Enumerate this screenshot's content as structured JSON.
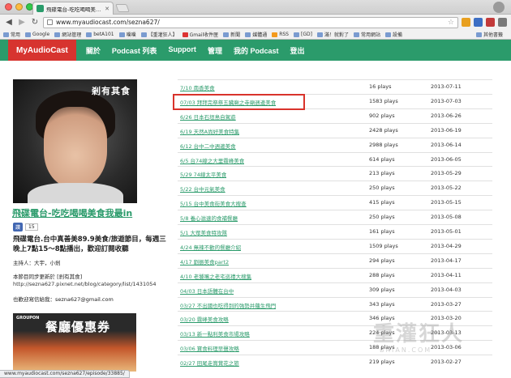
{
  "browser": {
    "tab_title": "飛碟電台-吃吃喝喝美食我最...",
    "url": "www.myaudiocast.com/sezna627/",
    "bookmarks": [
      "常用",
      "Google",
      "網站管理",
      "betA101",
      "噗噗",
      "【重灌狂人】",
      "Gmail收件匣",
      "新聞",
      "媒體通",
      "RSS",
      "[GD]",
      "滿！就對了",
      "常用網站",
      "設備"
    ],
    "bookmarks_more": "其他書籤",
    "status_url": "www.myaudiocast.com/sezna627/episode/33885/"
  },
  "nav": {
    "brand": "MyAudioCast",
    "links": [
      "關於",
      "Podcast 列表",
      "Support",
      "管理",
      "我的 Podcast",
      "登出"
    ]
  },
  "show": {
    "cover_text": "剎有其食",
    "title": "飛碟電台-吃吃喝喝美食我最in",
    "like_label": "讚",
    "like_count": "15",
    "description": "飛碟電台.台中真善美89.9美食/旅遊節目，每週三晚上7點15～8點播出，歡迎訂閱收聽",
    "hosts": "主持人：大宇，小剎",
    "sync_line": "本節目同步更新於 [剎有其食]",
    "sync_url": "http://sezna627.pixnet.net/blog/category/list/1431054",
    "email": "也歡迎寫信給我：sezna627@gmail.com",
    "ad_logo": "GROUPON",
    "ad_text": "餐廳優惠券"
  },
  "episodes": [
    {
      "title": "7/10 南香美食",
      "plays": "16 plays",
      "date": "2013-07-11"
    },
    {
      "title": "07/03 拜拜完祭祭五臟廟之寺廟週邊美食",
      "plays": "1583 plays",
      "date": "2013-07-03"
    },
    {
      "title": "6/26 日本石垣島自駕遊",
      "plays": "902 plays",
      "date": "2013-06-26"
    },
    {
      "title": "6/19 天然A尚好美食特集",
      "plays": "2428 plays",
      "date": "2013-06-19"
    },
    {
      "title": "6/12 台中二中週邊美食",
      "plays": "2988 plays",
      "date": "2013-06-14"
    },
    {
      "title": "6/5 台74線之大里霧峰美食",
      "plays": "614 plays",
      "date": "2013-06-05"
    },
    {
      "title": "5/29 74線太平美食",
      "plays": "213 plays",
      "date": "2013-05-29"
    },
    {
      "title": "5/22 台中元氣美食",
      "plays": "250 plays",
      "date": "2013-05-22"
    },
    {
      "title": "5/15 台中美食街美食大搜查",
      "plays": "415 plays",
      "date": "2013-05-15"
    },
    {
      "title": "5/8 養心滋速的食補餐廳",
      "plays": "250 plays",
      "date": "2013-05-08"
    },
    {
      "title": "5/1 大眾美食特攻隊",
      "plays": "161 plays",
      "date": "2013-05-01"
    },
    {
      "title": "4/24 無辣不歡的餐廳介紹",
      "plays": "1509 plays",
      "date": "2013-04-29"
    },
    {
      "title": "4/17 劉振美食part2",
      "plays": "294 plays",
      "date": "2013-04-17"
    },
    {
      "title": "4/10 老饕嘴之老宅巡禮大搜集",
      "plays": "288 plays",
      "date": "2013-04-11"
    },
    {
      "title": "04/03 日本語體在台中",
      "plays": "309 plays",
      "date": "2013-04-03"
    },
    {
      "title": "03/27 不出國也吃得到的強勢并蘊生飛門",
      "plays": "343 plays",
      "date": "2013-03-27"
    },
    {
      "title": "03/20 霧峰美食攻略",
      "plays": "346 plays",
      "date": "2013-03-20"
    },
    {
      "title": "03/13 新一點利美食市場攻略",
      "plays": "224 plays",
      "date": "2013-03-13"
    },
    {
      "title": "03/06 寶食料理早聲攻略",
      "plays": "188 plays",
      "date": "2013-03-06"
    },
    {
      "title": "02/27 田尾走賞賞花之旅",
      "plays": "219 plays",
      "date": "2013-02-27"
    }
  ],
  "watermark": "重灌狂人",
  "watermark_sub": "BRIAN.COM",
  "colors": {
    "nav_green": "#2b9b6b",
    "brand_red": "#d7342f",
    "highlight_red": "#d9332b",
    "link_green": "#2b9b6b"
  }
}
